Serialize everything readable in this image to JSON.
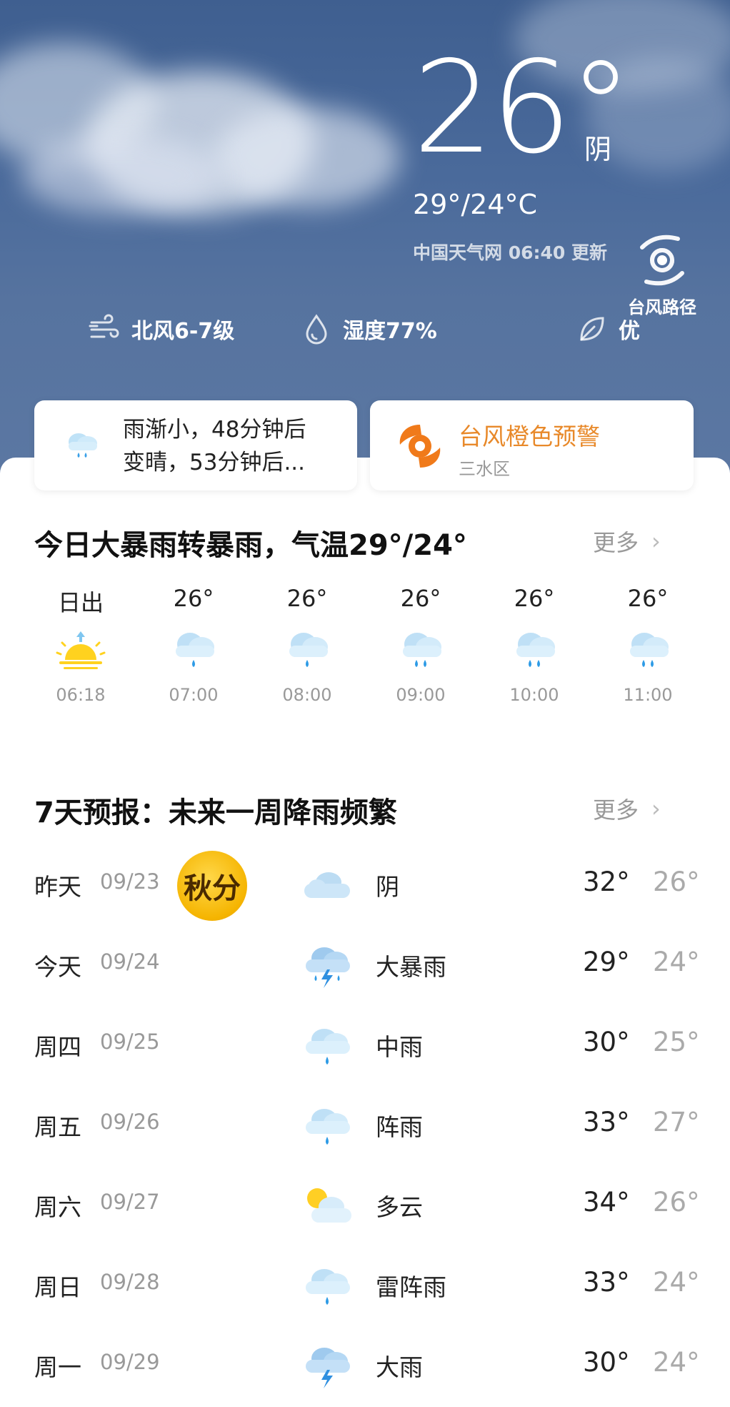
{
  "current": {
    "temperature": "26°",
    "condition": "阴",
    "range": "29°/24°C",
    "source": "中国天气网 06:40 更新",
    "typhoon_label": "台风路径"
  },
  "stats": {
    "wind": "北风6-7级",
    "humidity": "湿度77%",
    "air": "优"
  },
  "alerts": {
    "rain_line1": "雨渐小，48分钟后",
    "rain_line2": "变晴，53分钟后...",
    "typhoon_title": "台风橙色预警",
    "typhoon_area": "三水区"
  },
  "today": {
    "title": "今日大暴雨转暴雨，气温29°/24°",
    "more": "更多",
    "hours": [
      {
        "top": "日出",
        "time": "06:18",
        "icon": "sunrise-icon"
      },
      {
        "top": "26°",
        "time": "07:00",
        "icon": "light-rain-icon"
      },
      {
        "top": "26°",
        "time": "08:00",
        "icon": "light-rain-icon"
      },
      {
        "top": "26°",
        "time": "09:00",
        "icon": "rain-icon"
      },
      {
        "top": "26°",
        "time": "10:00",
        "icon": "rain-icon"
      },
      {
        "top": "26°",
        "time": "11:00",
        "icon": "rain-icon"
      }
    ]
  },
  "forecast": {
    "title": "7天预报：未来一周降雨频繁",
    "more": "更多",
    "badge": "秋分",
    "days": [
      {
        "day": "昨天",
        "date": "09/23",
        "icon": "cloudy-icon",
        "weather": "阴",
        "high": "32°",
        "low": "26°"
      },
      {
        "day": "今天",
        "date": "09/24",
        "icon": "thunder-rain-icon",
        "weather": "大暴雨",
        "high": "29°",
        "low": "24°"
      },
      {
        "day": "周四",
        "date": "09/25",
        "icon": "light-rain-icon",
        "weather": "中雨",
        "high": "30°",
        "low": "25°"
      },
      {
        "day": "周五",
        "date": "09/26",
        "icon": "light-rain-icon",
        "weather": "阵雨",
        "high": "33°",
        "low": "27°"
      },
      {
        "day": "周六",
        "date": "09/27",
        "icon": "partly-cloudy-icon",
        "weather": "多云",
        "high": "34°",
        "low": "26°"
      },
      {
        "day": "周日",
        "date": "09/28",
        "icon": "light-rain-icon",
        "weather": "雷阵雨",
        "high": "33°",
        "low": "24°"
      },
      {
        "day": "周一",
        "date": "09/29",
        "icon": "thunder-rain-icon",
        "weather": "大雨",
        "high": "30°",
        "low": "24°"
      }
    ]
  }
}
